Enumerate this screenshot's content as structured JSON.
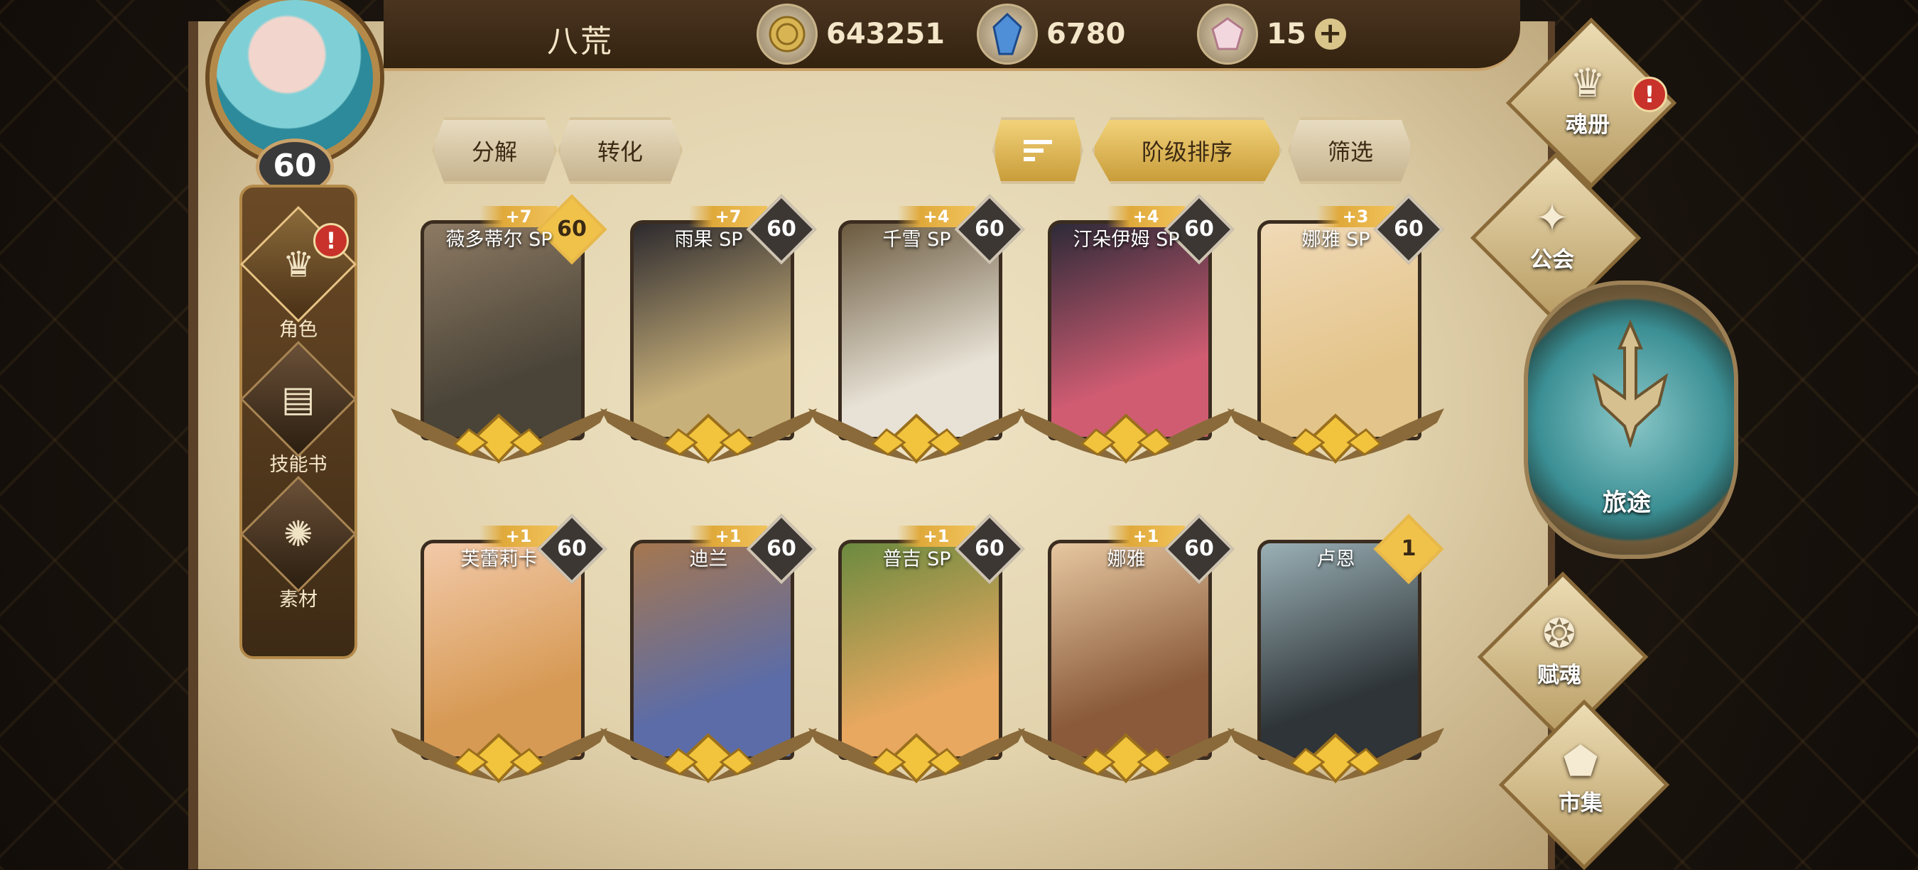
{
  "player": {
    "name": "八荒",
    "level": "60"
  },
  "currencies": [
    {
      "icon": "gold-coin-icon",
      "value": "643251"
    },
    {
      "icon": "blue-crystal-icon",
      "value": "6780"
    },
    {
      "icon": "pink-gem-icon",
      "value": "15"
    }
  ],
  "left_nav": [
    {
      "label": "角色",
      "icon": "helmet-icon",
      "alert": "!"
    },
    {
      "label": "技能书",
      "icon": "book-icon"
    },
    {
      "label": "素材",
      "icon": "beast-icon"
    }
  ],
  "toolbar": {
    "decompose": "分解",
    "convert": "转化",
    "order_sort": "阶级排序",
    "filter": "筛选",
    "sort_icon": "sort-icon"
  },
  "cards": [
    {
      "name": "薇多蒂尔 SP",
      "plus": "+7",
      "level": "60",
      "badge": "gold",
      "colors": [
        "#4a4438",
        "#8d7a63"
      ]
    },
    {
      "name": "雨果 SP",
      "plus": "+7",
      "level": "60",
      "badge": "silver",
      "colors": [
        "#c8b07a",
        "#2d2a2e"
      ]
    },
    {
      "name": "千雪 SP",
      "plus": "+4",
      "level": "60",
      "badge": "dark",
      "colors": [
        "#e8e2d6",
        "#6b5a3f"
      ]
    },
    {
      "name": "汀朵伊姆 SP",
      "plus": "+4",
      "level": "60",
      "badge": "dark",
      "colors": [
        "#d05c72",
        "#2d2a38"
      ]
    },
    {
      "name": "娜雅 SP",
      "plus": "+3",
      "level": "60",
      "badge": "silver",
      "colors": [
        "#e3c48a",
        "#f0d9b6"
      ]
    },
    {
      "name": "芙蕾莉卡",
      "plus": "+1",
      "level": "60",
      "badge": "silver",
      "colors": [
        "#d79a55",
        "#f2c9a8"
      ]
    },
    {
      "name": "迪兰",
      "plus": "+1",
      "level": "60",
      "badge": "silver",
      "colors": [
        "#5b6ca8",
        "#a5774f"
      ]
    },
    {
      "name": "普吉 SP",
      "plus": "+1",
      "level": "60",
      "badge": "dark",
      "colors": [
        "#e8a860",
        "#6b8a3f"
      ]
    },
    {
      "name": "娜雅",
      "plus": "+1",
      "level": "60",
      "badge": "dark",
      "colors": [
        "#8a5a3a",
        "#e6c7a0"
      ]
    },
    {
      "name": "卢恩",
      "plus": "",
      "level": "1",
      "badge": "gold",
      "colors": [
        "#2e3438",
        "#9ab0b5"
      ]
    }
  ],
  "right_nav": [
    {
      "label": "魂册",
      "icon": "helmet-icon",
      "alert": "!"
    },
    {
      "label": "公会",
      "icon": "eagle-icon"
    },
    {
      "label": "旅途",
      "icon": "trident-icon"
    },
    {
      "label": "赋魂",
      "icon": "flame-icon"
    },
    {
      "label": "市集",
      "icon": "pentagon-icon"
    }
  ]
}
